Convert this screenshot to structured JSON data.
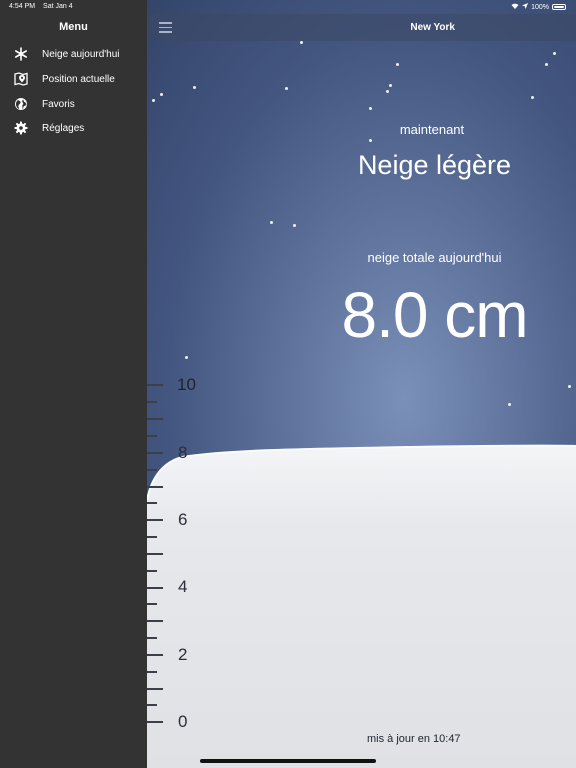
{
  "status_bar": {
    "time": "4:54 PM",
    "date": "Sat Jan 4",
    "battery": "100%"
  },
  "sidebar": {
    "title": "Menu",
    "items": [
      {
        "label": "Neige aujourd'hui",
        "icon": "snowflake-icon"
      },
      {
        "label": "Position actuelle",
        "icon": "map-pin-icon"
      },
      {
        "label": "Favoris",
        "icon": "globe-icon"
      },
      {
        "label": "Réglages",
        "icon": "gear-icon"
      }
    ]
  },
  "navbar": {
    "title": "New York",
    "menu_icon": "hamburger-icon"
  },
  "weather": {
    "now_label": "maintenant",
    "condition": "Neige légère",
    "total_label": "neige totale aujourd'hui",
    "total_value": "8.0 cm",
    "snow_depth_cm": 8.0
  },
  "ruler": {
    "labels": [
      "10",
      "8",
      "6",
      "4",
      "2",
      "0"
    ],
    "max_cm": 10
  },
  "footer": {
    "updated": "mis à jour en 10:47"
  },
  "colors": {
    "sidebar_bg": "#333333",
    "sky_top": "#34456a",
    "sky_glow": "#7b90b8",
    "snow": "#e9ebef"
  }
}
